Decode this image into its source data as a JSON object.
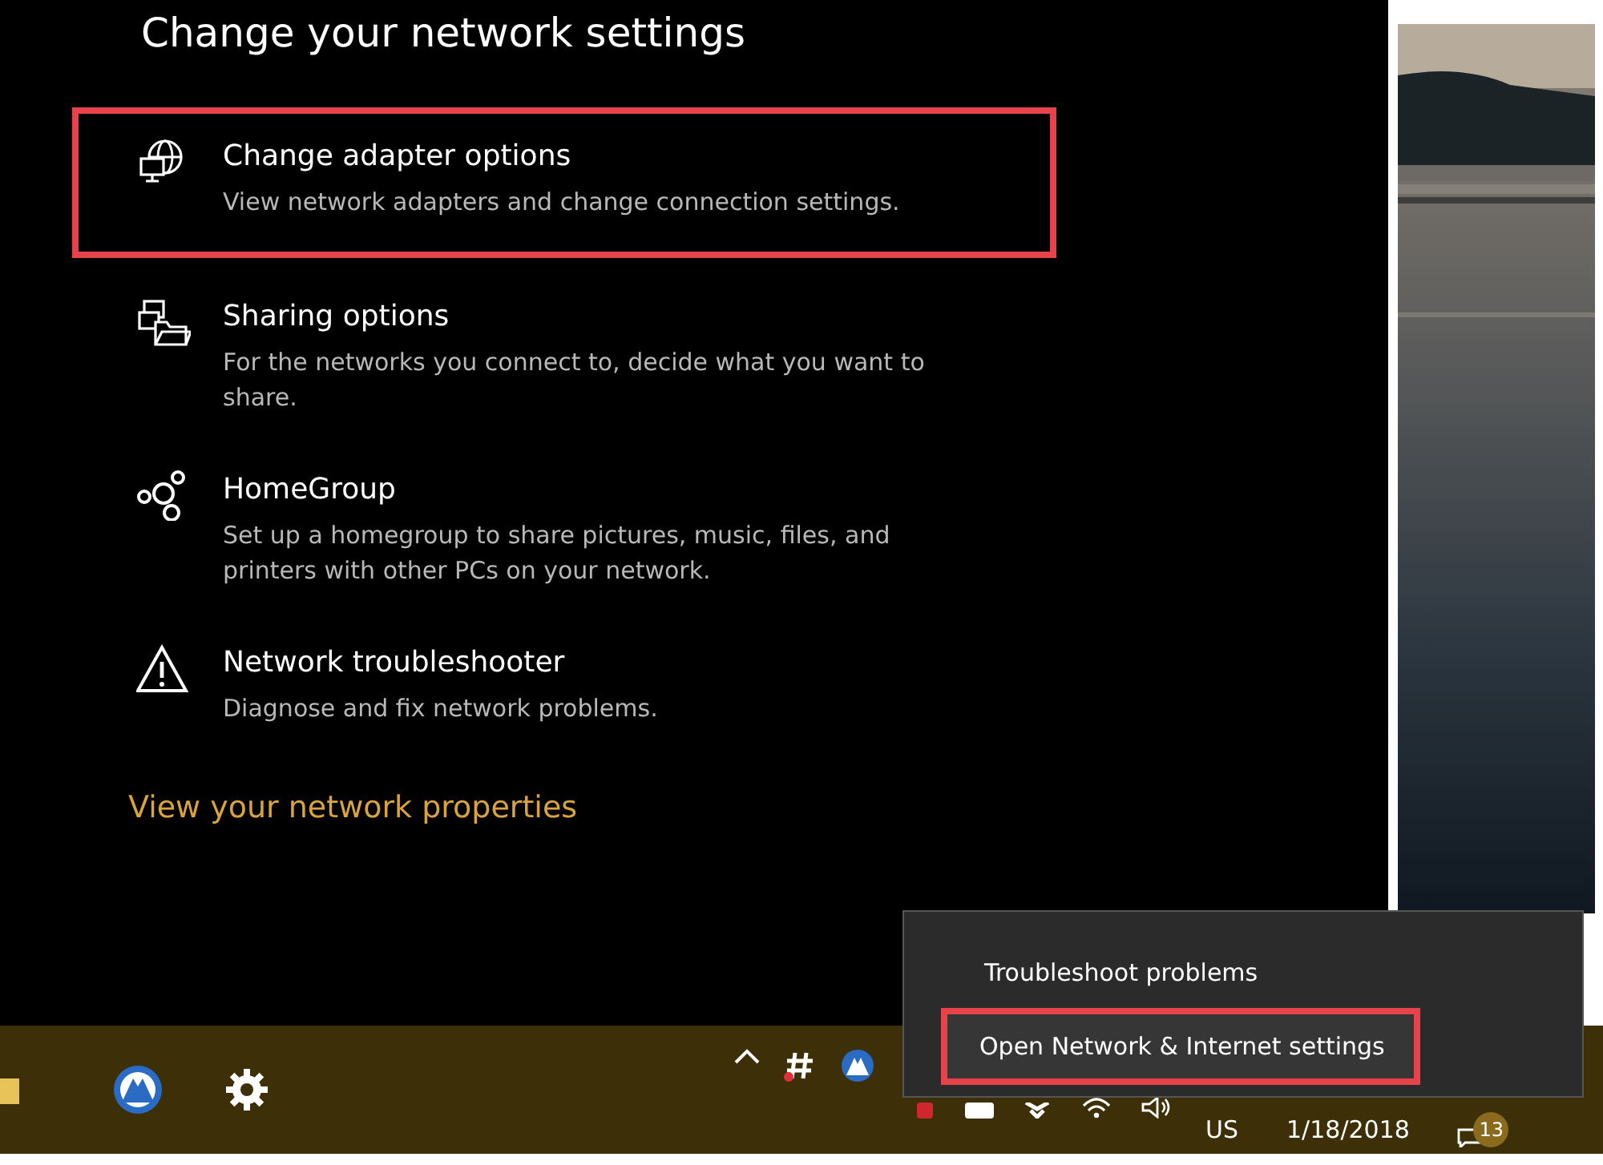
{
  "settings_panel": {
    "title": "Change your network settings",
    "items": [
      {
        "kind": "adapter",
        "title": "Change adapter options",
        "description": "View network adapters and change connection settings.",
        "highlighted": true
      },
      {
        "kind": "sharing",
        "title": "Sharing options",
        "description": "For the networks you connect to, decide what you want to share.",
        "highlighted": false
      },
      {
        "kind": "homegroup",
        "title": "HomeGroup",
        "description": "Set up a homegroup to share pictures, music, files, and printers with other PCs on your network.",
        "highlighted": false
      },
      {
        "kind": "troubleshooter",
        "title": "Network troubleshooter",
        "description": "Diagnose and fix network problems.",
        "highlighted": false
      }
    ],
    "link": "View your network properties"
  },
  "context_menu": {
    "items": [
      {
        "label": "Troubleshoot problems",
        "highlighted": false
      },
      {
        "label": "Open Network & Internet settings",
        "highlighted": true
      }
    ]
  },
  "taskbar": {
    "language": "US",
    "date": "1/18/2018",
    "notification_count": "13"
  }
}
